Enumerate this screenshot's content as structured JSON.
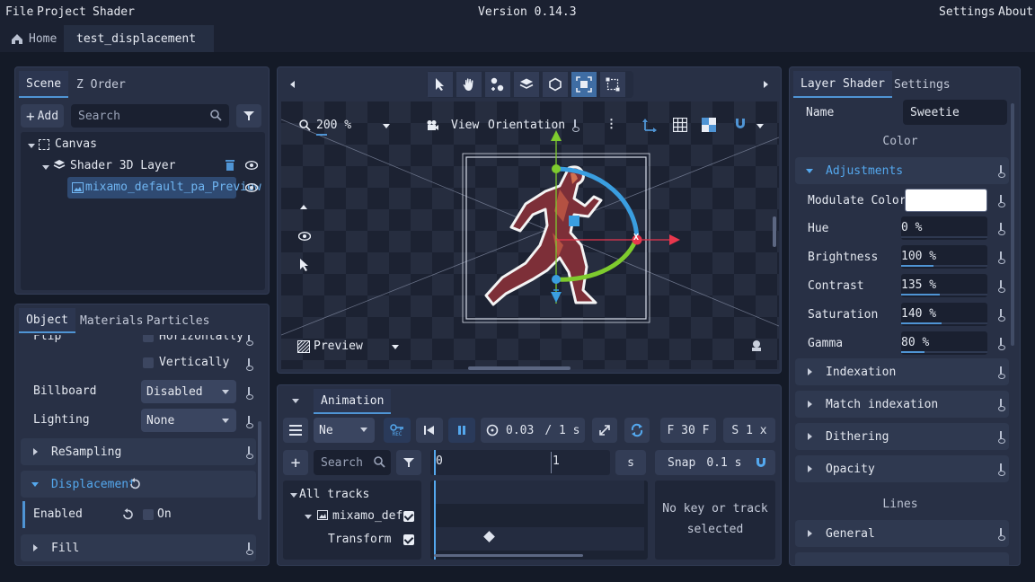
{
  "menu": {
    "file": "File",
    "project": "Project",
    "shader": "Shader",
    "version": "Version 0.14.3",
    "settings": "Settings",
    "about": "About"
  },
  "tabs": {
    "home": "Home",
    "current": "test_displacement"
  },
  "scene_panel": {
    "tabs": [
      "Scene",
      "Z Order"
    ],
    "add_label": "Add",
    "search_placeholder": "Search",
    "tree": {
      "canvas": "Canvas",
      "layer": "Shader 3D Layer",
      "sprite": "mixamo_default_pa_Preview"
    }
  },
  "object_panel": {
    "tabs": [
      "Object",
      "Materials",
      "Particles"
    ],
    "partial_label": "Flip",
    "partial_option": "Horizontally",
    "vertically": "Vertically",
    "billboard_label": "Billboard",
    "billboard_value": "Disabled",
    "lighting_label": "Lighting",
    "lighting_value": "None",
    "resampling": "ReSampling",
    "displacement": "Displacement",
    "enabled_label": "Enabled",
    "enabled_value": "On",
    "fill": "Fill"
  },
  "viewport": {
    "zoom": "200 %",
    "view": "View",
    "orientation": "Orientation",
    "preview": "Preview",
    "axis_x": "X"
  },
  "animation": {
    "title": "Animation",
    "track_select": "Ne",
    "rec": "REC",
    "time": "0.03",
    "duration": "/ 1 s",
    "fps": "F  30 F",
    "speed": "S  1 x",
    "search_placeholder": "Search",
    "timeline_start": "0",
    "timeline_one": "1",
    "unit": "s",
    "snap_label": "Snap",
    "snap_value": "0.1 s",
    "all_tracks": "All tracks",
    "track_name": "mixamo_def",
    "transform": "Transform",
    "no_key": "No key or track",
    "selected": "selected"
  },
  "layer_shader_panel": {
    "tabs": [
      "Layer Shader",
      "Settings"
    ],
    "name_label": "Name",
    "name_value": "Sweetie",
    "color_heading": "Color",
    "adjustments": "Adjustments",
    "modulate_label": "Modulate Color",
    "modulate_color": "#ffffff",
    "rows": [
      {
        "label": "Hue",
        "value": "0 %",
        "fill": 0.0
      },
      {
        "label": "Brightness",
        "value": "100 %",
        "fill": 0.37
      },
      {
        "label": "Contrast",
        "value": "135 %",
        "fill": 0.45
      },
      {
        "label": "Saturation",
        "value": "140 %",
        "fill": 0.47
      },
      {
        "label": "Gamma",
        "value": "80 %",
        "fill": 0.27
      }
    ],
    "sections": [
      "Indexation",
      "Match indexation",
      "Dithering",
      "Opacity"
    ],
    "lines_heading": "Lines",
    "general": "General"
  },
  "colors": {
    "accent": "#4f94d4",
    "panel": "#283045",
    "bg": "#141a27"
  }
}
